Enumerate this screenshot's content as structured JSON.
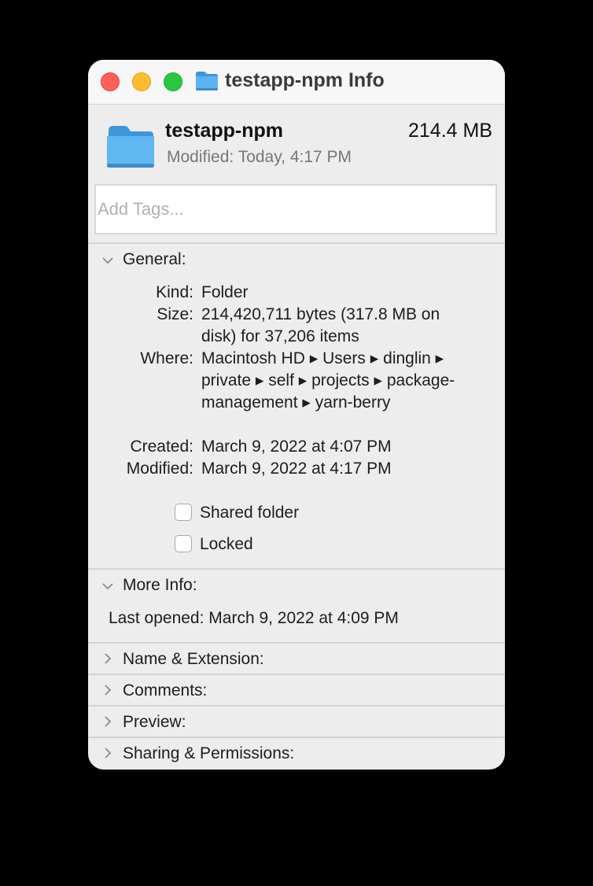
{
  "window": {
    "title": "testapp-npm Info",
    "title_icon": "folder-icon"
  },
  "header": {
    "name": "testapp-npm",
    "size": "214.4 MB",
    "modified_label": "Modified:",
    "modified_value": "Today, 4:17 PM",
    "icon": "folder-icon"
  },
  "tags": {
    "placeholder": "Add Tags...",
    "value": ""
  },
  "general": {
    "title": "General:",
    "expanded": true,
    "rows": [
      {
        "label": "Kind:",
        "value": "Folder"
      },
      {
        "label": "Size:",
        "value": "214,420,711 bytes (317.8 MB on disk) for 37,206 items"
      },
      {
        "label": "Where:",
        "value": "Macintosh HD ▸ Users ▸ dinglin ▸ private ▸ self ▸ projects ▸ package-management ▸ yarn-berry"
      },
      {
        "label": "Created:",
        "value": "March 9, 2022 at 4:07 PM"
      },
      {
        "label": "Modified:",
        "value": "March 9, 2022 at 4:17 PM"
      }
    ],
    "checkboxes": [
      {
        "label": "Shared folder",
        "checked": false
      },
      {
        "label": "Locked",
        "checked": false
      }
    ]
  },
  "more_info": {
    "title": "More Info:",
    "expanded": true,
    "last_opened_label": "Last opened:",
    "last_opened_value": "March 9, 2022 at 4:09 PM"
  },
  "collapsed_sections": [
    {
      "title": "Name & Extension:",
      "expanded": false
    },
    {
      "title": "Comments:",
      "expanded": false
    },
    {
      "title": "Preview:",
      "expanded": false
    },
    {
      "title": "Sharing & Permissions:",
      "expanded": false
    }
  ],
  "colors": {
    "close": "#fe5f57",
    "minimize": "#febb2e",
    "zoom": "#29c840",
    "folder_blue": "#5bb4f0",
    "window_bg": "#ededed"
  }
}
